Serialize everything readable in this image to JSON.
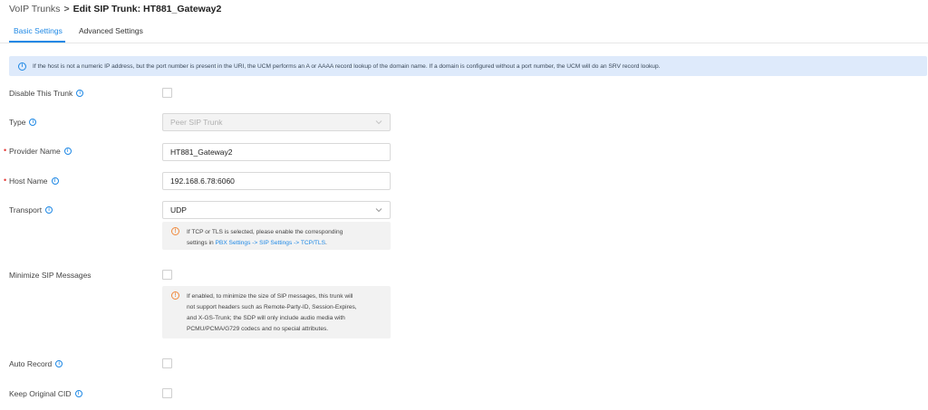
{
  "breadcrumb": {
    "parent": "VoIP Trunks",
    "separator": ">",
    "current": "Edit SIP Trunk: HT881_Gateway2"
  },
  "tabs": {
    "basic": "Basic Settings",
    "advanced": "Advanced Settings"
  },
  "banner": {
    "icon": "info-icon",
    "text": "If the host is not a numeric IP address, but the port number is present in the URI, the UCM performs an A or AAAA record lookup of the domain name. If a domain is configured without a port number, the UCM will do an SRV record lookup."
  },
  "form": {
    "disable_trunk": {
      "label": "Disable This Trunk",
      "checked": false
    },
    "type": {
      "label": "Type",
      "value": "Peer SIP Trunk"
    },
    "provider_name": {
      "label": "Provider Name",
      "value": "HT881_Gateway2"
    },
    "host_name": {
      "label": "Host Name",
      "value": "192.168.6.78:6060"
    },
    "transport": {
      "label": "Transport",
      "value": "UDP",
      "note_line1": "If TCP or TLS is selected, please enable the corresponding",
      "note_prefix": "settings in ",
      "note_link": "PBX Settings -> SIP Settings -> TCP/TLS",
      "note_suffix": "."
    },
    "minimize_sip": {
      "label": "Minimize SIP Messages",
      "checked": false,
      "note": [
        "If enabled, to minimize the size of SIP messages, this trunk will",
        "not support headers such as Remote-Party-ID, Session-Expires,",
        "and X-GS-Trunk; the SDP will only include audio media with",
        "PCMU/PCMA/G729 codecs and no special attributes."
      ]
    },
    "auto_record": {
      "label": "Auto Record",
      "checked": false
    },
    "keep_cid": {
      "label": "Keep Original CID",
      "checked": false
    }
  },
  "colors": {
    "accent": "#1e88e5",
    "banner_bg": "#deeafb",
    "required": "#e53935",
    "warning": "#f0883a"
  }
}
